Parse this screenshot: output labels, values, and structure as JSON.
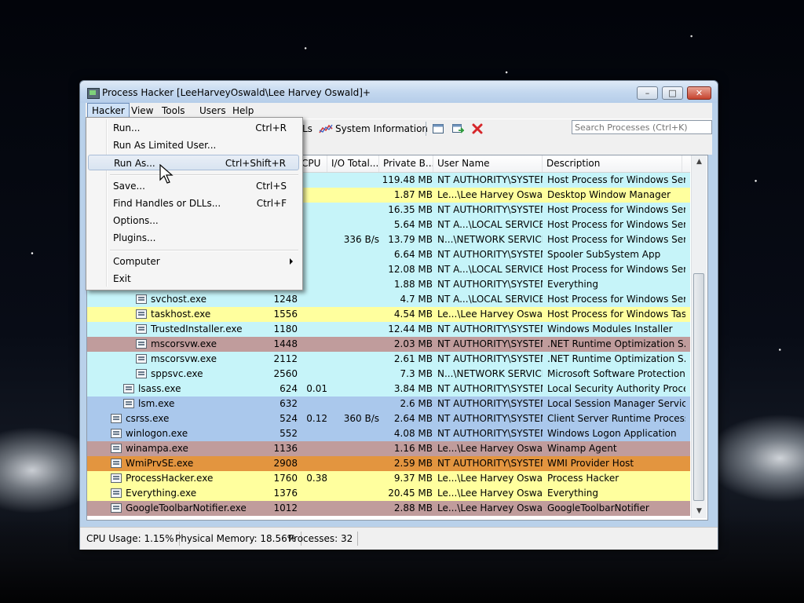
{
  "window": {
    "title": "Process Hacker [LeeHarveyOswald\\Lee Harvey Oswald]+",
    "buttons": {
      "minimize": "–",
      "maximize": "□",
      "close": "✕"
    }
  },
  "menubar": [
    "Hacker",
    "View",
    "Tools",
    "Users",
    "Help"
  ],
  "toolbar": {
    "handles_partial": "Ls",
    "system_information": "System Information",
    "search_placeholder": "Search Processes (Ctrl+K)"
  },
  "columns": {
    "cpu": "CPU",
    "io_total": "I/O Total...",
    "private_bytes": "Private B...",
    "user_name": "User Name",
    "description": "Description"
  },
  "hacker_menu": {
    "items": [
      {
        "label": "Run...",
        "shortcut": "Ctrl+R"
      },
      {
        "label": "Run As Limited User...",
        "shortcut": ""
      },
      {
        "label": "Run As...",
        "shortcut": "Ctrl+Shift+R"
      },
      {
        "label": "Save...",
        "shortcut": "Ctrl+S"
      },
      {
        "label": "Find Handles or DLLs...",
        "shortcut": "Ctrl+F"
      },
      {
        "label": "Options...",
        "shortcut": ""
      },
      {
        "label": "Plugins...",
        "shortcut": ""
      },
      {
        "label": "Computer",
        "shortcut": ""
      },
      {
        "label": "Exit",
        "shortcut": ""
      }
    ]
  },
  "processes": [
    {
      "name": "",
      "pid": "",
      "cpu": "",
      "io": "",
      "private": "119.48 MB",
      "user": "NT AUTHORITY\\SYSTEM",
      "desc": "Host Process for Windows Ser...",
      "color": "#c6f4f9",
      "indent": 0
    },
    {
      "name": "",
      "pid": "",
      "cpu": "",
      "io": "",
      "private": "1.87 MB",
      "user": "Le...\\Lee Harvey Oswald",
      "desc": "Desktop Window Manager",
      "color": "#ffff9e",
      "indent": 0
    },
    {
      "name": "",
      "pid": "",
      "cpu": "",
      "io": "",
      "private": "16.35 MB",
      "user": "NT AUTHORITY\\SYSTEM",
      "desc": "Host Process for Windows Ser...",
      "color": "#c6f4f9",
      "indent": 0
    },
    {
      "name": "",
      "pid": "",
      "cpu": "",
      "io": "",
      "private": "5.64 MB",
      "user": "NT A...\\LOCAL SERVICE",
      "desc": "Host Process for Windows Ser...",
      "color": "#c6f4f9",
      "indent": 0
    },
    {
      "name": "",
      "pid": "",
      "cpu": "",
      "io": "336 B/s",
      "private": "13.79 MB",
      "user": "N...\\NETWORK SERVICE",
      "desc": "Host Process for Windows Ser...",
      "color": "#c6f4f9",
      "indent": 0
    },
    {
      "name": "",
      "pid": "",
      "cpu": "",
      "io": "",
      "private": "6.64 MB",
      "user": "NT AUTHORITY\\SYSTEM",
      "desc": "Spooler SubSystem App",
      "color": "#c6f4f9",
      "indent": 0
    },
    {
      "name": "",
      "pid": "",
      "cpu": "",
      "io": "",
      "private": "12.08 MB",
      "user": "NT A...\\LOCAL SERVICE",
      "desc": "Host Process for Windows Ser...",
      "color": "#c6f4f9",
      "indent": 0
    },
    {
      "name": "",
      "pid": "",
      "cpu": "",
      "io": "",
      "private": "1.88 MB",
      "user": "NT AUTHORITY\\SYSTEM",
      "desc": "Everything",
      "color": "#c6f4f9",
      "indent": 0
    },
    {
      "name": "svchost.exe",
      "pid": "1248",
      "cpu": "",
      "io": "",
      "private": "4.7 MB",
      "user": "NT A...\\LOCAL SERVICE",
      "desc": "Host Process for Windows Ser...",
      "color": "#c6f4f9",
      "indent": 3
    },
    {
      "name": "taskhost.exe",
      "pid": "1556",
      "cpu": "",
      "io": "",
      "private": "4.54 MB",
      "user": "Le...\\Lee Harvey Oswald",
      "desc": "Host Process for Windows Tas...",
      "color": "#ffff9e",
      "indent": 3
    },
    {
      "name": "TrustedInstaller.exe",
      "pid": "1180",
      "cpu": "",
      "io": "",
      "private": "12.44 MB",
      "user": "NT AUTHORITY\\SYSTEM",
      "desc": "Windows Modules Installer",
      "color": "#c6f4f9",
      "indent": 3
    },
    {
      "name": "mscorsvw.exe",
      "pid": "1448",
      "cpu": "",
      "io": "",
      "private": "2.03 MB",
      "user": "NT AUTHORITY\\SYSTEM",
      "desc": ".NET Runtime Optimization S...",
      "color": "#c09c9c",
      "indent": 3
    },
    {
      "name": "mscorsvw.exe",
      "pid": "2112",
      "cpu": "",
      "io": "",
      "private": "2.61 MB",
      "user": "NT AUTHORITY\\SYSTEM",
      "desc": ".NET Runtime Optimization S...",
      "color": "#c6f4f9",
      "indent": 3
    },
    {
      "name": "sppsvc.exe",
      "pid": "2560",
      "cpu": "",
      "io": "",
      "private": "7.3 MB",
      "user": "N...\\NETWORK SERVICE",
      "desc": "Microsoft Software Protection...",
      "color": "#c6f4f9",
      "indent": 3
    },
    {
      "name": "lsass.exe",
      "pid": "624",
      "cpu": "0.01",
      "io": "",
      "private": "3.84 MB",
      "user": "NT AUTHORITY\\SYSTEM",
      "desc": "Local Security Authority Proce...",
      "color": "#c6f4f9",
      "indent": 2
    },
    {
      "name": "lsm.exe",
      "pid": "632",
      "cpu": "",
      "io": "",
      "private": "2.6 MB",
      "user": "NT AUTHORITY\\SYSTEM",
      "desc": "Local Session Manager Service",
      "color": "#aac8ec",
      "indent": 2
    },
    {
      "name": "csrss.exe",
      "pid": "524",
      "cpu": "0.12",
      "io": "360 B/s",
      "private": "2.64 MB",
      "user": "NT AUTHORITY\\SYSTEM",
      "desc": "Client Server Runtime Process",
      "color": "#aac8ec",
      "indent": 1
    },
    {
      "name": "winlogon.exe",
      "pid": "552",
      "cpu": "",
      "io": "",
      "private": "4.08 MB",
      "user": "NT AUTHORITY\\SYSTEM",
      "desc": "Windows Logon Application",
      "color": "#aac8ec",
      "indent": 1
    },
    {
      "name": "winampa.exe",
      "pid": "1136",
      "cpu": "",
      "io": "",
      "private": "1.16 MB",
      "user": "Le...\\Lee Harvey Oswald",
      "desc": "Winamp Agent",
      "color": "#c09c9c",
      "indent": 1
    },
    {
      "name": "WmiPrvSE.exe",
      "pid": "2908",
      "cpu": "",
      "io": "",
      "private": "2.59 MB",
      "user": "NT AUTHORITY\\SYSTEM",
      "desc": "WMI Provider Host",
      "color": "#e3953f",
      "indent": 1
    },
    {
      "name": "ProcessHacker.exe",
      "pid": "1760",
      "cpu": "0.38",
      "io": "",
      "private": "9.37 MB",
      "user": "Le...\\Lee Harvey Oswald",
      "desc": "Process Hacker",
      "color": "#ffff9e",
      "indent": 1
    },
    {
      "name": "Everything.exe",
      "pid": "1376",
      "cpu": "",
      "io": "",
      "private": "20.45 MB",
      "user": "Le...\\Lee Harvey Oswald",
      "desc": "Everything",
      "color": "#ffff9e",
      "indent": 1
    },
    {
      "name": "GoogleToolbarNotifier.exe",
      "pid": "1012",
      "cpu": "",
      "io": "",
      "private": "2.88 MB",
      "user": "Le...\\Lee Harvey Oswald",
      "desc": "GoogleToolbarNotifier",
      "color": "#c09c9c",
      "indent": 1
    }
  ],
  "statusbar": {
    "cpu_usage": "CPU Usage: 1.15%",
    "physical_memory": "Physical Memory: 18.56%",
    "processes": "Processes: 32"
  }
}
